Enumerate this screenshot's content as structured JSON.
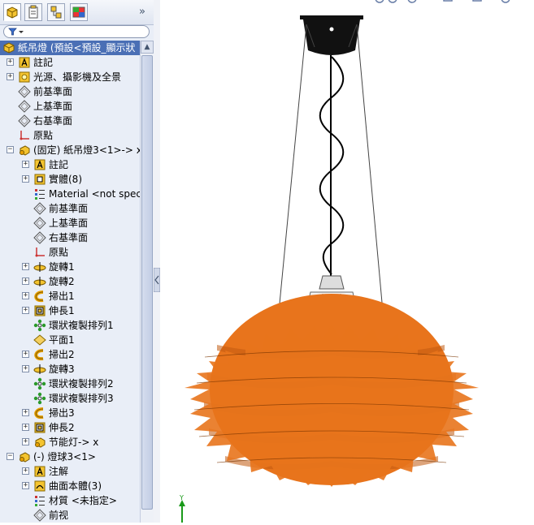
{
  "panel": {
    "tabs": [
      {
        "name": "feature-manager-tab",
        "active": true
      },
      {
        "name": "property-manager-tab",
        "active": false
      },
      {
        "name": "configuration-manager-tab",
        "active": false
      },
      {
        "name": "display-manager-tab",
        "active": false
      }
    ],
    "more_symbol": "»",
    "filter_icon": "funnel-icon"
  },
  "tree": [
    {
      "depth": 0,
      "expander": "",
      "icon": "assembly-icon",
      "label": "紙吊燈 (預設<預設_顯示狀",
      "selected": true
    },
    {
      "depth": 0,
      "expander": "+",
      "icon": "annotation-icon",
      "label": "註記"
    },
    {
      "depth": 0,
      "expander": "+",
      "icon": "light-icon",
      "label": "光源、攝影機及全景"
    },
    {
      "depth": 0,
      "expander": "",
      "icon": "plane-icon",
      "label": "前基準面"
    },
    {
      "depth": 0,
      "expander": "",
      "icon": "plane-icon",
      "label": "上基準面"
    },
    {
      "depth": 0,
      "expander": "",
      "icon": "plane-icon",
      "label": "右基準面"
    },
    {
      "depth": 0,
      "expander": "",
      "icon": "origin-icon",
      "label": "原點"
    },
    {
      "depth": 0,
      "expander": "−",
      "icon": "part-icon",
      "label": "(固定) 紙吊燈3<1>-> x"
    },
    {
      "depth": 1,
      "expander": "+",
      "icon": "annotation-icon",
      "label": "註記"
    },
    {
      "depth": 1,
      "expander": "+",
      "icon": "solid-bodies-icon",
      "label": "實體(8)"
    },
    {
      "depth": 1,
      "expander": "",
      "icon": "material-icon",
      "label": "Material <not specified>"
    },
    {
      "depth": 1,
      "expander": "",
      "icon": "plane-icon",
      "label": "前基準面"
    },
    {
      "depth": 1,
      "expander": "",
      "icon": "plane-icon",
      "label": "上基準面"
    },
    {
      "depth": 1,
      "expander": "",
      "icon": "plane-icon",
      "label": "右基準面"
    },
    {
      "depth": 1,
      "expander": "",
      "icon": "origin-icon",
      "label": "原點"
    },
    {
      "depth": 1,
      "expander": "+",
      "icon": "revolve-icon",
      "label": "旋轉1"
    },
    {
      "depth": 1,
      "expander": "+",
      "icon": "revolve-icon",
      "label": "旋轉2"
    },
    {
      "depth": 1,
      "expander": "+",
      "icon": "sweep-icon",
      "label": "掃出1"
    },
    {
      "depth": 1,
      "expander": "+",
      "icon": "extrude-icon",
      "label": "伸長1"
    },
    {
      "depth": 1,
      "expander": "",
      "icon": "circular-pattern-icon",
      "label": "環狀複製排列1"
    },
    {
      "depth": 1,
      "expander": "",
      "icon": "plane-feature-icon",
      "label": "平面1"
    },
    {
      "depth": 1,
      "expander": "+",
      "icon": "sweep-icon",
      "label": "掃出2"
    },
    {
      "depth": 1,
      "expander": "+",
      "icon": "revolve-icon",
      "label": "旋轉3"
    },
    {
      "depth": 1,
      "expander": "",
      "icon": "circular-pattern-icon",
      "label": "環狀複製排列2"
    },
    {
      "depth": 1,
      "expander": "",
      "icon": "circular-pattern-icon",
      "label": "環狀複製排列3"
    },
    {
      "depth": 1,
      "expander": "+",
      "icon": "sweep-icon",
      "label": "掃出3"
    },
    {
      "depth": 1,
      "expander": "+",
      "icon": "extrude-icon",
      "label": "伸長2"
    },
    {
      "depth": 1,
      "expander": "+",
      "icon": "part-icon",
      "label": "节能灯-> x"
    },
    {
      "depth": 0,
      "expander": "−",
      "icon": "part-icon",
      "label": "(-) 燈球3<1>"
    },
    {
      "depth": 1,
      "expander": "+",
      "icon": "annotation-icon",
      "label": "注解"
    },
    {
      "depth": 1,
      "expander": "+",
      "icon": "surface-bodies-icon",
      "label": "曲面本體(3)"
    },
    {
      "depth": 1,
      "expander": "",
      "icon": "material-icon",
      "label": "材質 <未指定>"
    },
    {
      "depth": 1,
      "expander": "",
      "icon": "plane-icon",
      "label": "前视"
    }
  ],
  "viewport": {
    "axis_label": "Y",
    "lamp_color": "#e8741c",
    "canopy_color": "#111111"
  }
}
